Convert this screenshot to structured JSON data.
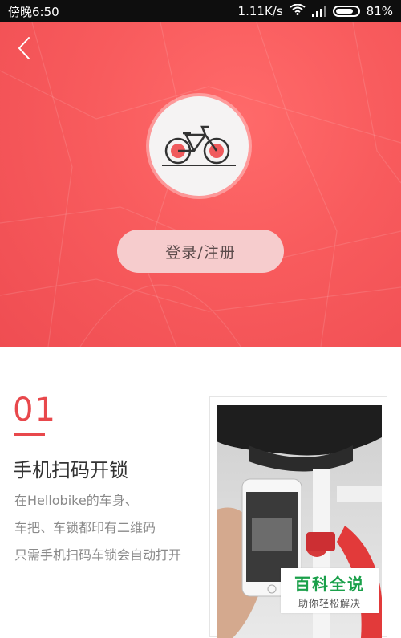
{
  "status_bar": {
    "carrier_time": "傍晚6:50",
    "network_speed": "1.11K/s",
    "battery_percent": "81%",
    "battery_level": 0.81,
    "icons": [
      "wifi-icon",
      "signal-icon",
      "battery-icon"
    ]
  },
  "header": {
    "back_icon": "chevron-left-icon",
    "avatar_icon": "bicycle-icon",
    "login_label": "登录/注册"
  },
  "step": {
    "number": "01",
    "title": "手机扫码开锁",
    "lines": [
      "在Hellobike的车身、",
      "车把、车锁都印有二维码",
      "只需手机扫码车锁会自动打开"
    ]
  },
  "watermark": {
    "title": "百科全说",
    "subtitle": "助你轻松解决"
  },
  "colors": {
    "accent": "#e8484c",
    "hero_bg": "#f85b5d",
    "login_bg": "#f6cccd",
    "watermark_green": "#1aa04a"
  }
}
